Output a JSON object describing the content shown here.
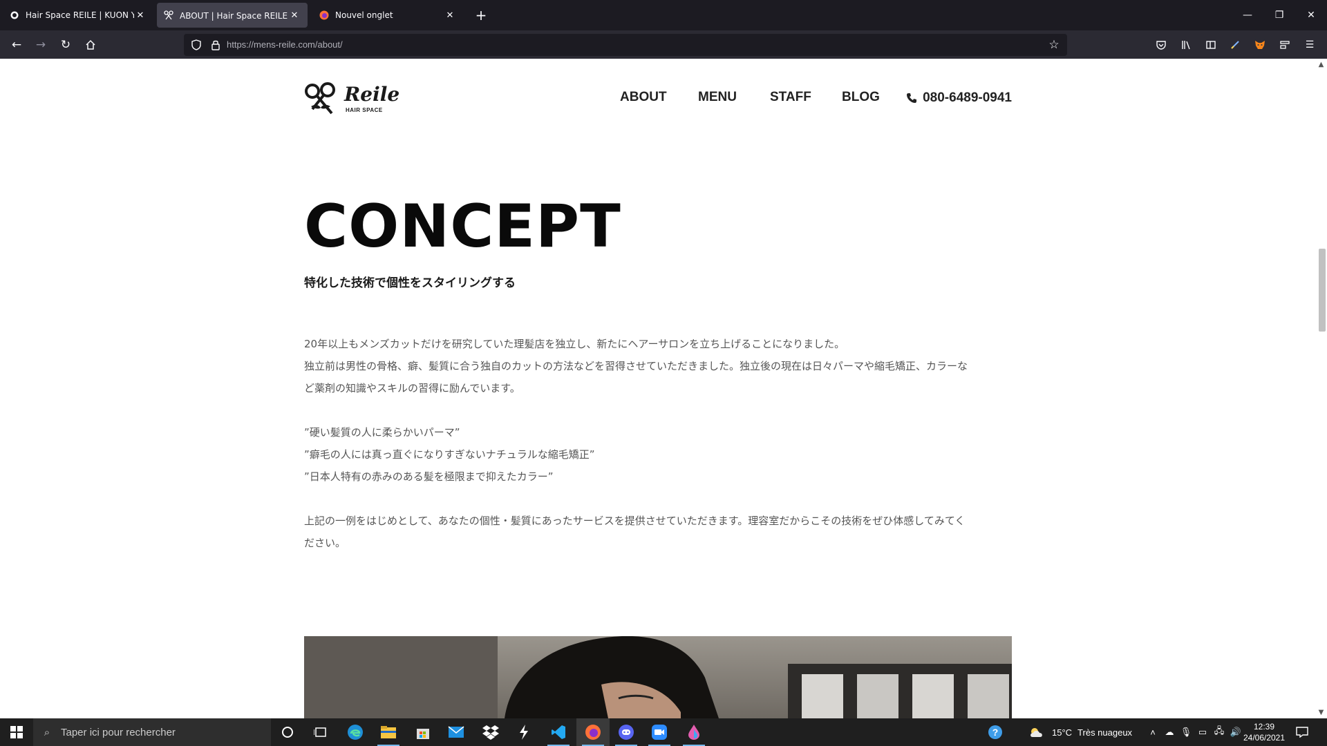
{
  "browser": {
    "tabs": [
      {
        "title": "Hair Space REILE | KUON YAGI P",
        "active": false
      },
      {
        "title": "ABOUT | Hair Space REILE - ヘア",
        "active": true
      },
      {
        "title": "Nouvel onglet",
        "active": false
      }
    ],
    "url": {
      "host": "https://mens-reile.com",
      "path": "/about/"
    }
  },
  "site": {
    "logo": {
      "text": "Reile",
      "sub": "HAIR SPACE"
    },
    "nav": [
      {
        "label": "ABOUT"
      },
      {
        "label": "MENU"
      },
      {
        "label": "STAFF"
      },
      {
        "label": "BLOG"
      }
    ],
    "phone": "080-6489-0941"
  },
  "concept": {
    "heading": "CONCEPT",
    "subtitle": "特化した技術で個性をスタイリングする",
    "paragraphs": [
      "20年以上もメンズカットだけを研究していた理髪店を独立し、新たにヘアーサロンを立ち上げることになりました。",
      "独立前は男性の骨格、癖、髪質に合う独自のカットの方法などを習得させていただきました。独立後の現在は日々パーマや縮毛矯正、カラーな",
      "ど薬剤の知識やスキルの習得に励んでいます。",
      "”硬い髪質の人に柔らかいパーマ”",
      "”癖毛の人には真っ直ぐになりすぎないナチュラルな縮毛矯正”",
      "”日本人特有の赤みのある髪を極限まで抑えたカラー”",
      "上記の一例をはじめとして、あなたの個性・髪質にあったサービスを提供させていただきます。理容室だからこその技術をぜひ体感してみてく",
      "ださい。"
    ]
  },
  "taskbar": {
    "search_placeholder": "Taper ici pour rechercher",
    "weather": {
      "temp": "15°C",
      "desc": "Très nuageux"
    },
    "time": "12:39",
    "date": "24/06/2021"
  }
}
